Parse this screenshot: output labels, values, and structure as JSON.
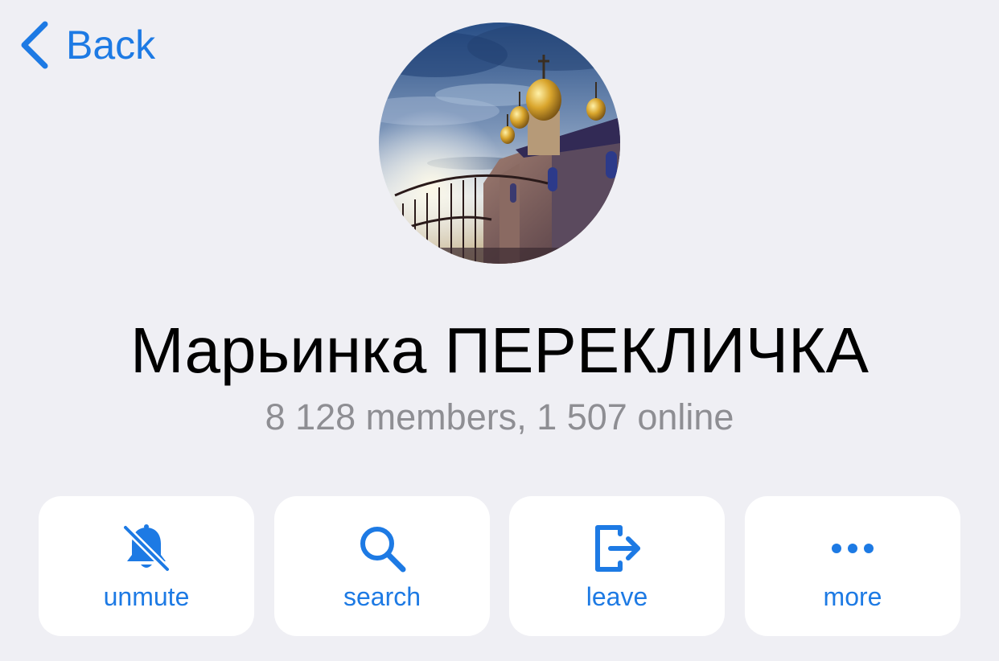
{
  "nav": {
    "back_label": "Back",
    "back_icon": "chevron-left-icon"
  },
  "profile": {
    "avatar": "church-photo-avatar",
    "name": "Марьинка ПЕРЕКЛИЧКА",
    "stats": "8 128 members, 1 507 online"
  },
  "actions": [
    {
      "label": "unmute",
      "icon": "bell-slash-icon"
    },
    {
      "label": "search",
      "icon": "magnifier-icon"
    },
    {
      "label": "leave",
      "icon": "leave-icon"
    },
    {
      "label": "more",
      "icon": "ellipsis-icon"
    }
  ],
  "colors": {
    "background": "#efeff4",
    "accent": "#1d7ae4",
    "title": "#000000",
    "secondary": "#8e8e93",
    "card": "#ffffff"
  }
}
